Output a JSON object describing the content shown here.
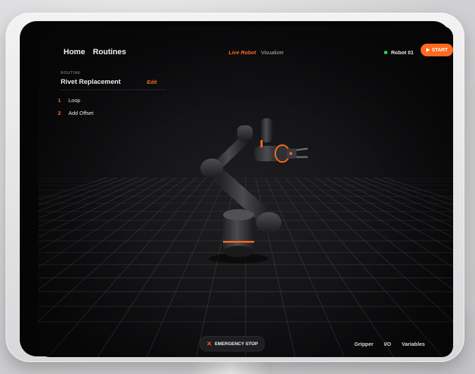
{
  "nav": {
    "home": "Home",
    "routines": "Routines"
  },
  "tabs": {
    "live_robot": "Live Robot",
    "visualizer": "Visualizer"
  },
  "robot": {
    "name": "Robot 01",
    "status_color": "#2fd160"
  },
  "start_button": {
    "label": "START",
    "icon": "play-icon"
  },
  "routine": {
    "kicker": "ROUTINE",
    "title": "Rivet Replacement",
    "edit_label": "Edit",
    "steps": [
      {
        "num": "1",
        "label": "Loop"
      },
      {
        "num": "2",
        "label": "Add Offset"
      }
    ]
  },
  "emergency_stop": {
    "label": "EMERGENCY STOP",
    "icon": "close-icon"
  },
  "bottom_tabs": [
    "Gripper",
    "I/O",
    "Variables"
  ],
  "colors": {
    "accent": "#ff6a1f",
    "screen_bg": "#0e0e10",
    "device_frame": "#e6e6e8"
  }
}
